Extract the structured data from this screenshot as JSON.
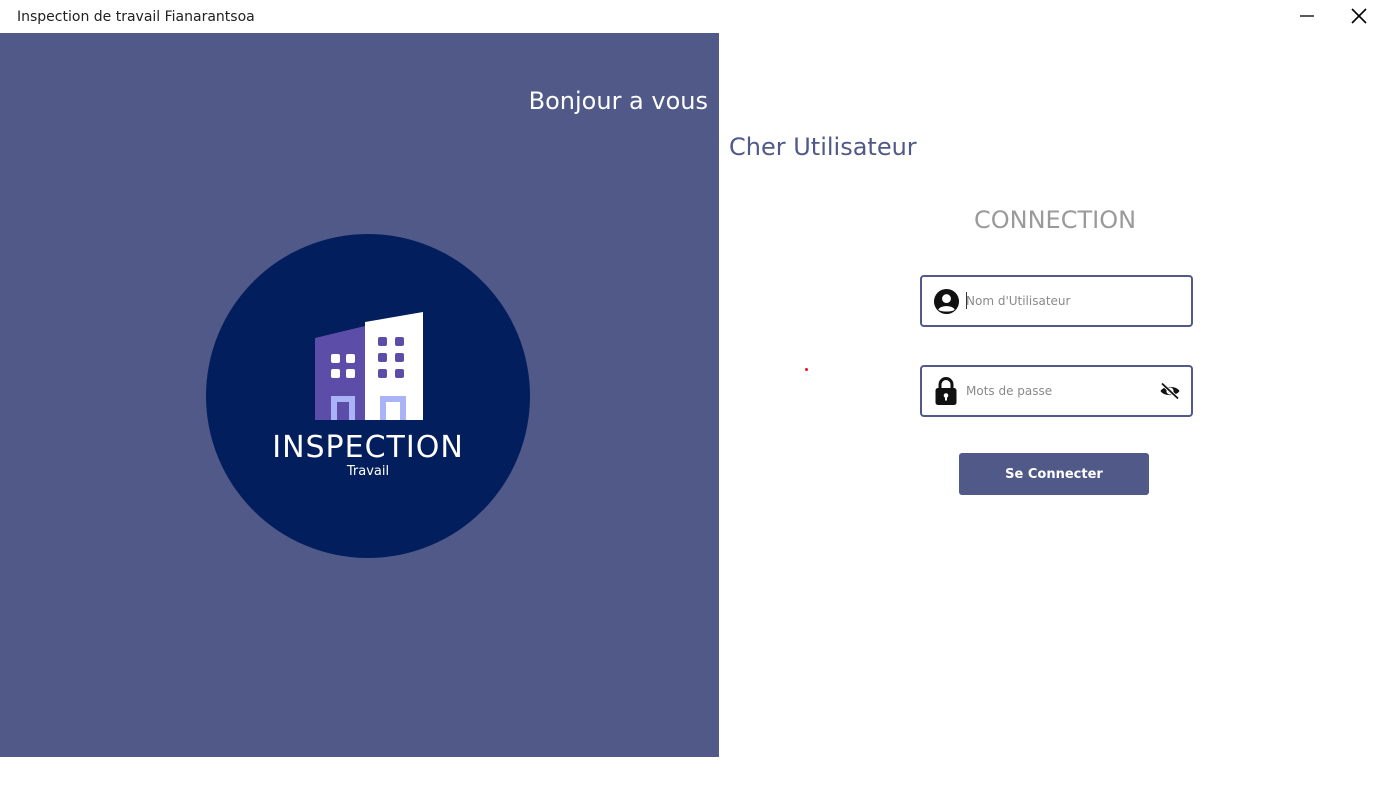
{
  "window": {
    "title": "Inspection de travail Fianarantsoa",
    "minimize_icon": "minimize-icon",
    "close_icon": "close-icon"
  },
  "left_panel": {
    "greeting": "Bonjour a vous",
    "background_color": "#505987",
    "logo": {
      "title": "INSPECTION",
      "subtitle": "Travail",
      "circle_color": "#031e5c",
      "icon": "buildings-icon"
    }
  },
  "right_panel": {
    "subheading": "Cher Utilisateur",
    "form_title": "CONNECTION",
    "username": {
      "placeholder": "Nom d'Utilisateur",
      "value": "",
      "icon": "user-icon"
    },
    "password": {
      "placeholder": "Mots de passe",
      "value": "",
      "icon": "lock-icon",
      "toggle_icon": "eye-off-icon"
    },
    "submit_label": "Se Connecter",
    "accent_color": "#505987"
  }
}
